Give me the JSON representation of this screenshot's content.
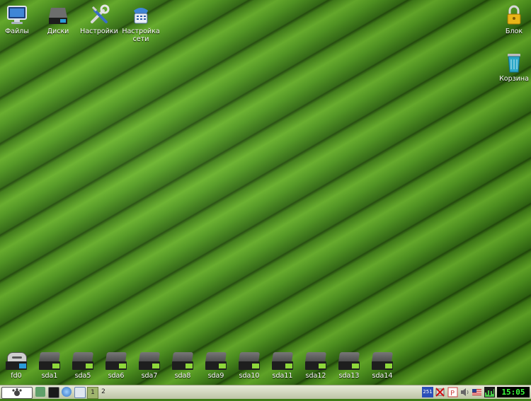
{
  "desktop": {
    "top_icons": [
      {
        "label": "Файлы",
        "icon": "monitor-icon"
      },
      {
        "label": "Диски",
        "icon": "drive-icon"
      },
      {
        "label": "Настройки",
        "icon": "tools-icon"
      },
      {
        "label": "Настройка сети",
        "icon": "network-phone-icon"
      }
    ],
    "right_icons": [
      {
        "label": "Блок",
        "icon": "lock-icon"
      },
      {
        "label": "Корзина",
        "icon": "trash-icon"
      }
    ],
    "drives": [
      "fd0",
      "sda1",
      "sda5",
      "sda6",
      "sda7",
      "sda8",
      "sda9",
      "sda10",
      "sda11",
      "sda12",
      "sda13",
      "sda14"
    ]
  },
  "taskbar": {
    "pager": [
      "1",
      "2"
    ],
    "tray_badge": "251",
    "clock": "15:05"
  },
  "colors": {
    "led_green": "#8ed83a",
    "led_blue": "#2a9bd9"
  }
}
